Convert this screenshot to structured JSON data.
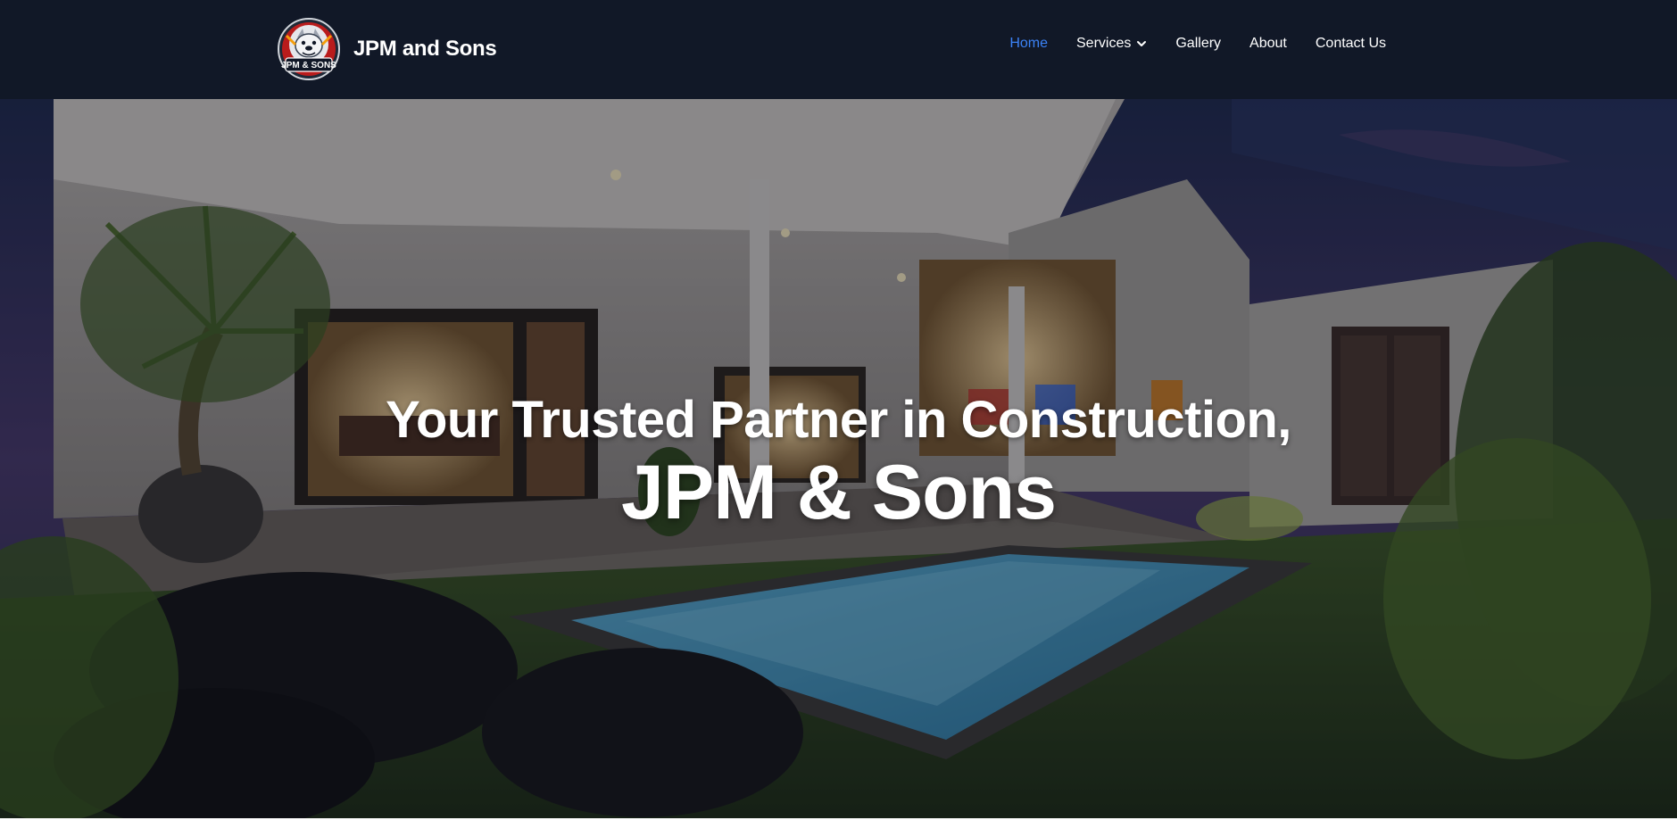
{
  "header": {
    "brand_name": "JPM and Sons",
    "logo_text": "JPM & SONS",
    "logo_icon": "bulldog-crest-logo"
  },
  "nav": {
    "items": [
      {
        "label": "Home",
        "active": true
      },
      {
        "label": "Services",
        "has_dropdown": true
      },
      {
        "label": "Gallery"
      },
      {
        "label": "About"
      },
      {
        "label": "Contact Us"
      }
    ],
    "active_color": "#3b82f6"
  },
  "hero": {
    "heading_line1": "Your Trusted Partner in Construction,",
    "heading_line2": "JPM & Sons",
    "background": "night villa pool courtyard"
  },
  "colors": {
    "navbar_bg": "#111827",
    "text": "#ffffff",
    "accent": "#3b82f6"
  }
}
